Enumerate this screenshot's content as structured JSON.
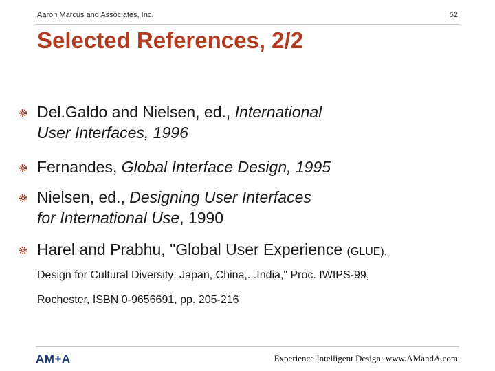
{
  "header": {
    "company": "Aaron Marcus and Associates, Inc.",
    "page_number": "52"
  },
  "title": "Selected References, 2/2",
  "references": [
    {
      "line1_plain": "Del.Galdo and Nielsen, ed., ",
      "line1_italic": "International",
      "line2_italic": "User Interfaces, 1996"
    },
    {
      "plain": "Fernandes, ",
      "italic": "Global Interface Design, 1995"
    },
    {
      "line1_plain": "Nielsen, ed., ",
      "line1_italic": "Designing User Interfaces",
      "line2_italic": "for International Use",
      "line2_plain": ", 1990"
    },
    {
      "line1_plain": "Harel and Prabhu, \"Global User Experience ",
      "line1_small": "(GLUE),",
      "line2": "Design for Cultural Diversity: Japan, China,...India,\" Proc. IWIPS-99,",
      "line3": "Rochester, ISBN 0-9656691, pp. 205-216"
    }
  ],
  "bullet_icon": "gear-bullet-icon",
  "colors": {
    "title": "#b23a1e",
    "bullet": "#b23a1e",
    "logo": "#1f3d7a"
  },
  "footer": {
    "logo": "AM+A",
    "tagline": "Experience Intelligent Design: www.AMandA.com"
  }
}
